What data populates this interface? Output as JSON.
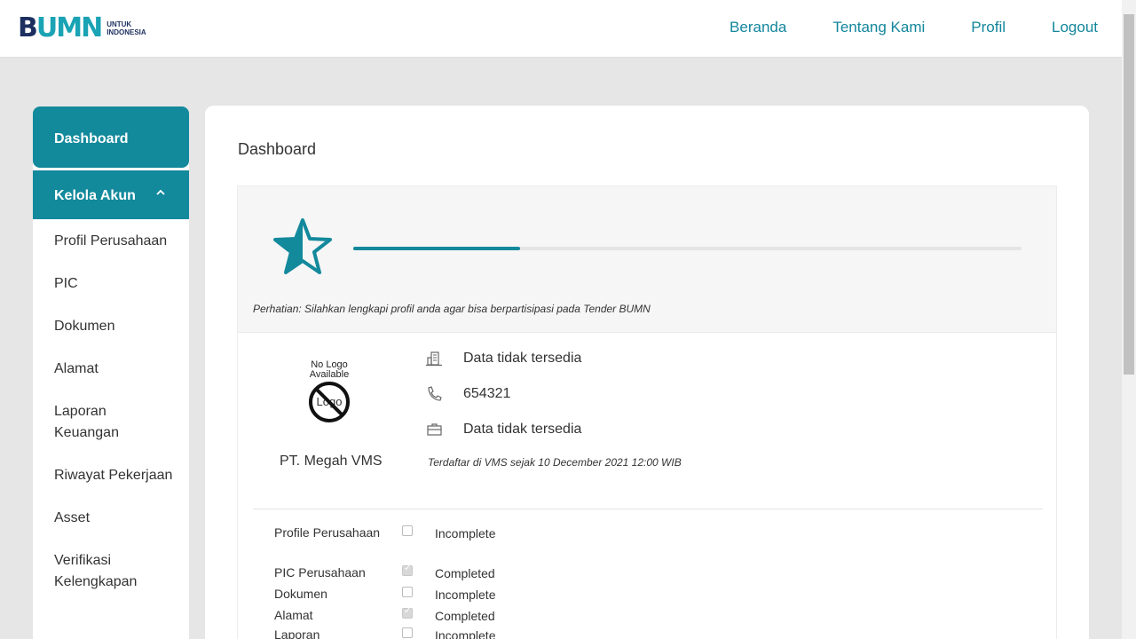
{
  "header": {
    "logo_mark_b": "B",
    "logo_mark_umn": "UMN",
    "logo_sub_1": "UNTUK",
    "logo_sub_2": "INDONESIA",
    "nav": [
      "Beranda",
      "Tentang Kami",
      "Profil",
      "Logout"
    ]
  },
  "sidebar": {
    "dashboard": "Dashboard",
    "kelola_akun": "Kelola Akun",
    "items": [
      "Profil Perusahaan",
      "PIC",
      "Dokumen",
      "Alamat",
      "Laporan Keuangan",
      "Riwayat Pekerjaan",
      "Asset",
      "Verifikasi Kelengkapan"
    ]
  },
  "main": {
    "title": "Dashboard",
    "progress_fraction": 0.25,
    "notice": "Perhatian: Silahkan lengkapi profil anda agar bisa berpartisipasi pada Tender BUMN",
    "no_logo_line1": "No Logo",
    "no_logo_line2": "Available",
    "no_logo_word": "Logo",
    "company_name": "PT. Megah VMS",
    "industry": "Data tidak tersedia",
    "phone": "654321",
    "business": "Data tidak tersedia",
    "registered": "Terdaftar di VMS sejak 10 December 2021 12:00 WIB",
    "status": [
      {
        "label": "Profile Perusahaan",
        "checked": false,
        "value": "Incomplete"
      },
      {
        "label": "PIC Perusahaan",
        "checked": true,
        "value": "Completed"
      },
      {
        "label": "Dokumen",
        "checked": false,
        "value": "Incomplete"
      },
      {
        "label": "Alamat",
        "checked": true,
        "value": "Completed"
      },
      {
        "label": "Laporan",
        "checked": false,
        "value": "Incomplete"
      }
    ]
  },
  "colors": {
    "brand": "#13899c",
    "nav_link": "#13869b",
    "logo_dark": "#1c2f5f"
  }
}
